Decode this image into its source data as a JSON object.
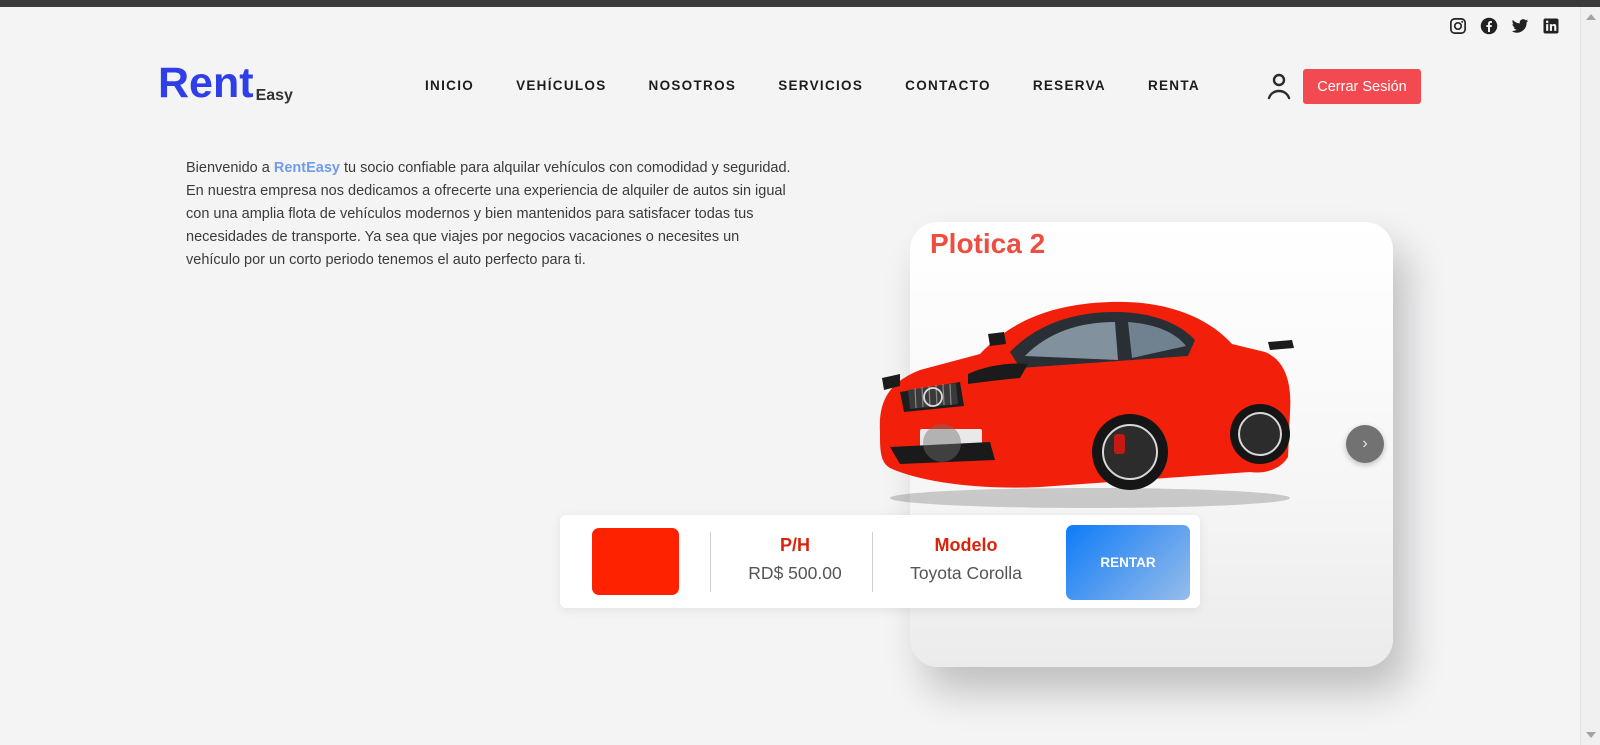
{
  "social": [
    {
      "icon": "instagram-icon"
    },
    {
      "icon": "facebook-icon"
    },
    {
      "icon": "twitter-icon"
    },
    {
      "icon": "linkedin-icon"
    }
  ],
  "logo": {
    "main": "Rent",
    "sub": "Easy"
  },
  "nav": [
    "INICIO",
    "VEHÍCULOS",
    "NOSOTROS",
    "SERVICIOS",
    "CONTACTO",
    "RESERVA",
    "RENTA"
  ],
  "header": {
    "logout_label": "Cerrar Sesión"
  },
  "intro": {
    "prefix": "Bienvenido a ",
    "brand": "RentEasy",
    "text": " tu socio confiable para alquilar vehículos con comodidad y seguridad. En nuestra empresa nos dedicamos a ofrecerte una experiencia de alquiler de autos sin igual con una amplia flota de vehículos modernos y bien mantenidos para satisfacer todas tus necesidades de transporte. Ya sea que viajes por negocios vacaciones o necesites un vehículo por un corto periodo tenemos el auto perfecto para ti."
  },
  "vehicle": {
    "title": "Plotica 2",
    "color": "#ff2200",
    "price_label": "P/H",
    "price": "RD$ 500.00",
    "model_label": "Modelo",
    "model": "Toyota Corolla",
    "rent_label": "RENTAR",
    "next_glyph": "›"
  },
  "colors": {
    "accent": "#f24a50",
    "logo": "#2e3fe8",
    "label": "#d9230c"
  }
}
